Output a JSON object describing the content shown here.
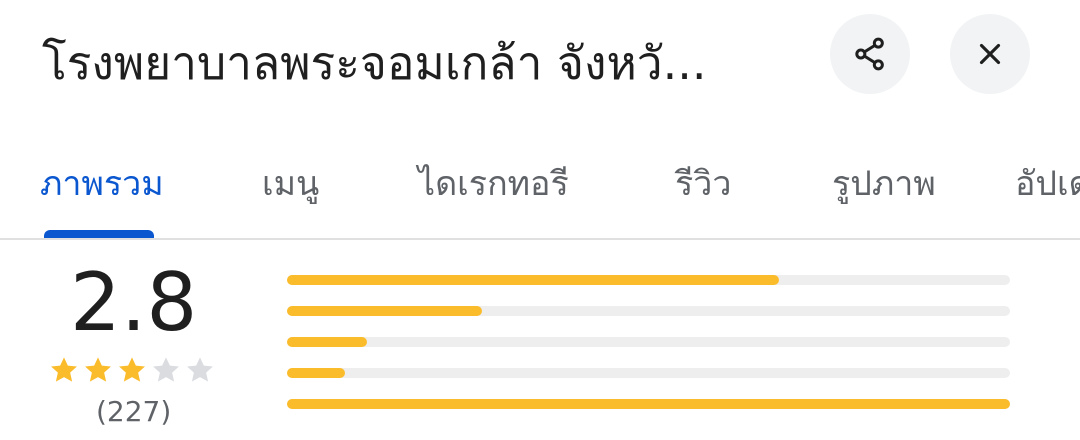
{
  "header": {
    "title": "โรงพยาบาลพระจอมเกล้า จังหวั...",
    "share_icon": "share-icon",
    "close_icon": "close-icon"
  },
  "tabs": [
    {
      "label": "ภาพรวม",
      "active": true
    },
    {
      "label": "เมนู",
      "active": false
    },
    {
      "label": "ไดเรกทอรี",
      "active": false
    },
    {
      "label": "รีวิว",
      "active": false
    },
    {
      "label": "รูปภาพ",
      "active": false
    },
    {
      "label": "อัปเด",
      "active": false
    }
  ],
  "rating": {
    "score": "2.8",
    "stars_filled": 3,
    "stars_total": 5,
    "count": "(227)",
    "distribution": [
      0.68,
      0.27,
      0.11,
      0.08,
      1.0
    ]
  },
  "colors": {
    "accent": "#0b57d0",
    "star": "#fbbc2c",
    "star_empty": "#dadce0",
    "bar_bg": "#eeeeee"
  }
}
